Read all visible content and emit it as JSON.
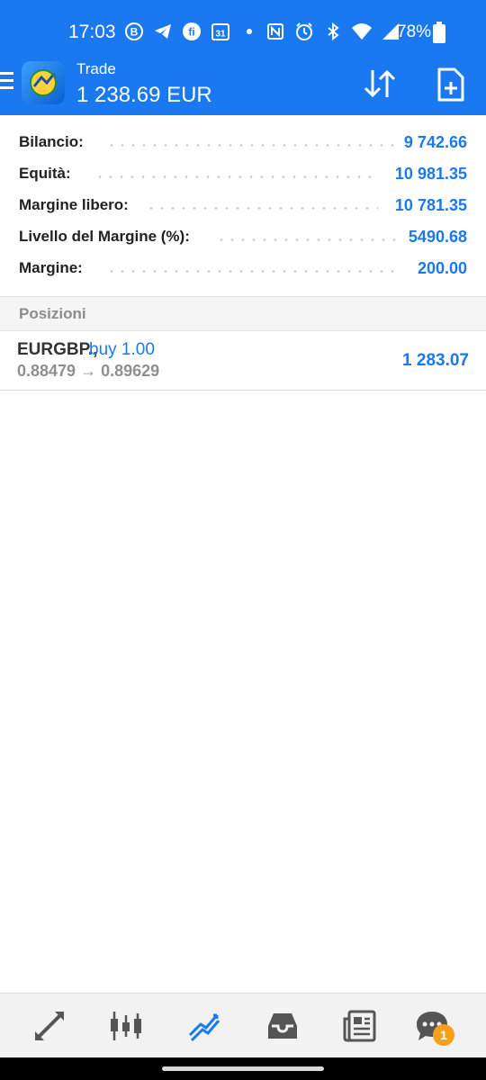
{
  "status_bar": {
    "time": "17:03",
    "battery": "78%",
    "calendar_day": "31",
    "icons_left": [
      "b-circle-icon",
      "telegram-icon",
      "fi-icon",
      "calendar-icon",
      "dot-icon"
    ],
    "icons_right": [
      "nfc-icon",
      "alarm-icon",
      "bluetooth-icon",
      "wifi-icon",
      "signal-icon",
      "battery-icon"
    ]
  },
  "app_bar": {
    "title": "Trade",
    "balance": "1 238.69 EUR",
    "accent": "#1a79f0"
  },
  "summary": {
    "rows": [
      {
        "label": "Bilancio:",
        "value": "9 742.66"
      },
      {
        "label": "Equità:",
        "value": "10 981.35"
      },
      {
        "label": "Margine libero:",
        "value": "10 781.35"
      },
      {
        "label": "Livello del Margine (%):",
        "value": "5490.68"
      },
      {
        "label": "Margine:",
        "value": "200.00"
      }
    ]
  },
  "positions": {
    "header": "Posizioni",
    "items": [
      {
        "symbol": "EURGBP.,",
        "direction": "buy 1.00",
        "prices": "0.88479 → 0.89629",
        "profit": "1 283.07"
      }
    ]
  },
  "bottom_nav": {
    "items": [
      "quotes-icon",
      "chart-icon",
      "trade-icon",
      "history-icon",
      "news-icon",
      "chat-icon"
    ],
    "active": "trade-icon",
    "chat_badge": "1",
    "badge_color": "#f7a01b"
  }
}
